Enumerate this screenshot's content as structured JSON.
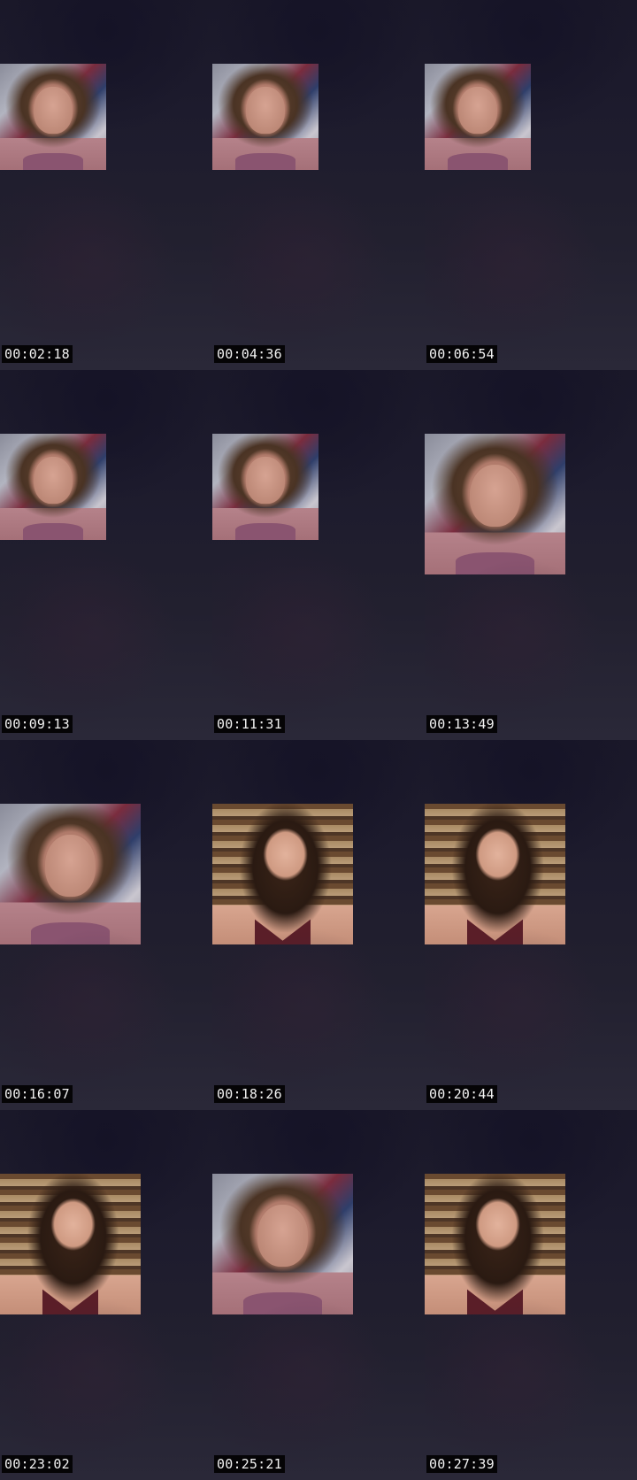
{
  "contact_sheet": {
    "frames": [
      {
        "timestamp": "00:02:18",
        "thumbnail": "selfie-bedroom"
      },
      {
        "timestamp": "00:04:36",
        "thumbnail": "selfie-bedroom"
      },
      {
        "timestamp": "00:06:54",
        "thumbnail": "selfie-bedroom"
      },
      {
        "timestamp": "00:09:13",
        "thumbnail": "selfie-bedroom"
      },
      {
        "timestamp": "00:11:31",
        "thumbnail": "selfie-bedroom"
      },
      {
        "timestamp": "00:13:49",
        "thumbnail": "selfie-bedroom"
      },
      {
        "timestamp": "00:16:07",
        "thumbnail": "selfie-bedroom"
      },
      {
        "timestamp": "00:18:26",
        "thumbnail": "portrait-library"
      },
      {
        "timestamp": "00:20:44",
        "thumbnail": "portrait-library"
      },
      {
        "timestamp": "00:23:02",
        "thumbnail": "portrait-library"
      },
      {
        "timestamp": "00:25:21",
        "thumbnail": "selfie-bedroom"
      },
      {
        "timestamp": "00:27:39",
        "thumbnail": "portrait-library"
      }
    ]
  },
  "colors": {
    "background": "#181628",
    "timestamp_bg": "#000000",
    "timestamp_text": "#f2f2f2"
  }
}
